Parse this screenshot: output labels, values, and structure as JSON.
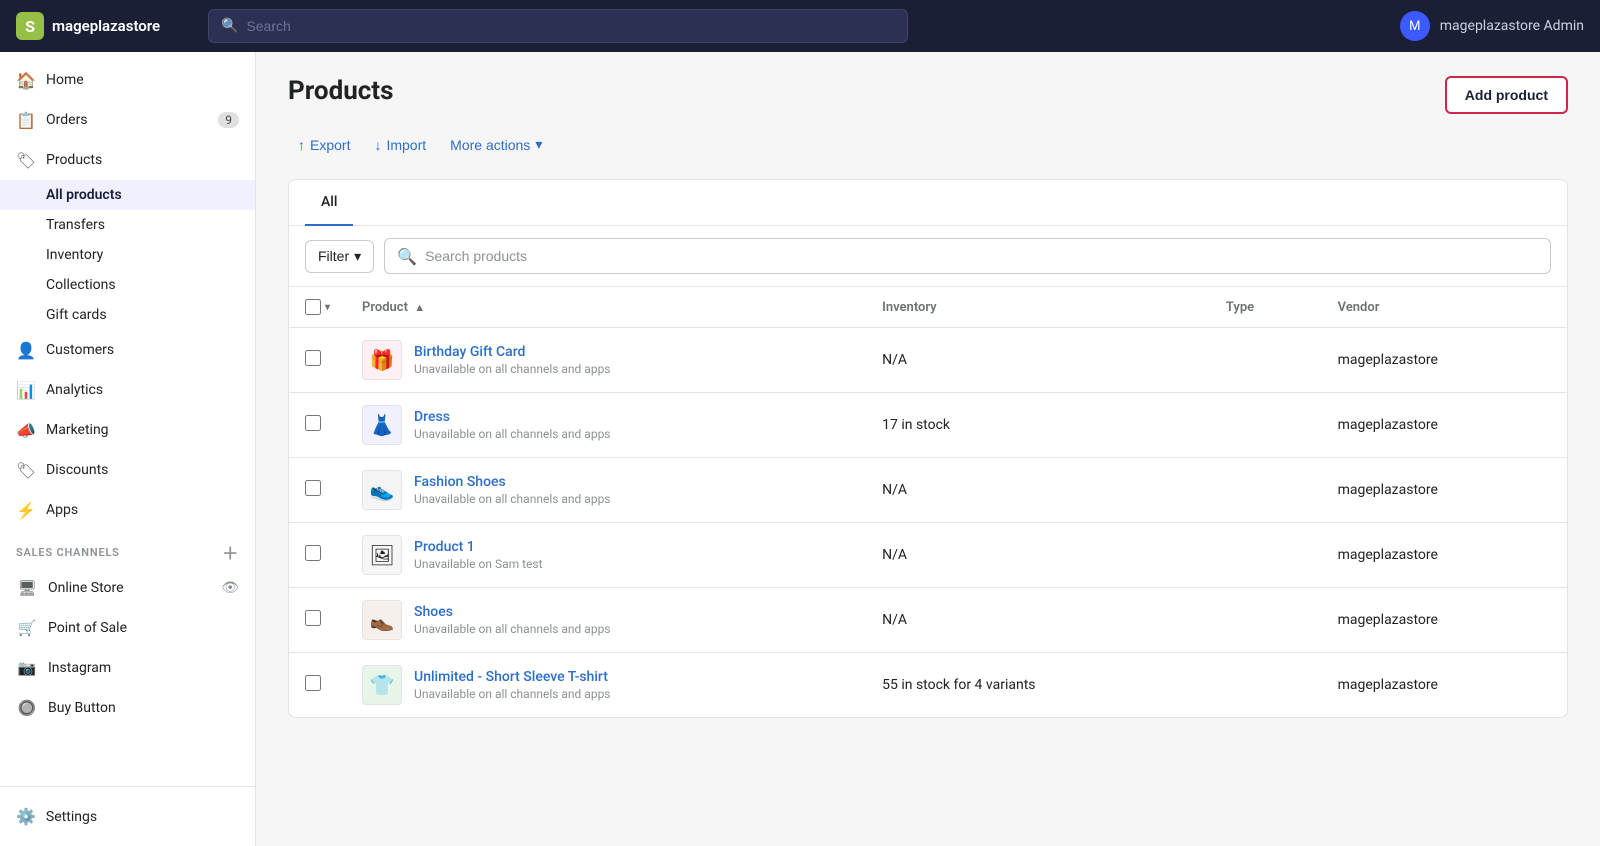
{
  "topbar": {
    "brand_name": "mageplazastore",
    "search_placeholder": "Search",
    "user_name": "mageplazastore Admin"
  },
  "sidebar": {
    "nav_items": [
      {
        "id": "home",
        "label": "Home",
        "icon": "🏠",
        "badge": null
      },
      {
        "id": "orders",
        "label": "Orders",
        "icon": "📋",
        "badge": "9"
      },
      {
        "id": "products",
        "label": "Products",
        "icon": "🏷",
        "badge": null,
        "expanded": true
      }
    ],
    "products_sub": [
      {
        "id": "all-products",
        "label": "All products",
        "active": true
      },
      {
        "id": "transfers",
        "label": "Transfers"
      },
      {
        "id": "inventory",
        "label": "Inventory"
      },
      {
        "id": "collections",
        "label": "Collections"
      },
      {
        "id": "gift-cards",
        "label": "Gift cards"
      }
    ],
    "other_nav": [
      {
        "id": "customers",
        "label": "Customers",
        "icon": "👤"
      },
      {
        "id": "analytics",
        "label": "Analytics",
        "icon": "📊"
      },
      {
        "id": "marketing",
        "label": "Marketing",
        "icon": "📣"
      },
      {
        "id": "discounts",
        "label": "Discounts",
        "icon": "🏷"
      },
      {
        "id": "apps",
        "label": "Apps",
        "icon": "⚡"
      }
    ],
    "sales_channels_label": "SALES CHANNELS",
    "sales_channels": [
      {
        "id": "online-store",
        "label": "Online Store",
        "icon": "🖥",
        "has_eye": true
      },
      {
        "id": "point-of-sale",
        "label": "Point of Sale",
        "icon": "🛒"
      },
      {
        "id": "instagram",
        "label": "Instagram",
        "icon": "📷"
      },
      {
        "id": "buy-button",
        "label": "Buy Button",
        "icon": "🔘"
      }
    ],
    "settings_label": "Settings"
  },
  "page": {
    "title": "Products",
    "add_product_label": "Add product",
    "export_label": "Export",
    "import_label": "Import",
    "more_actions_label": "More actions",
    "tabs": [
      {
        "id": "all",
        "label": "All",
        "active": true
      }
    ],
    "filter_label": "Filter",
    "search_placeholder": "Search products",
    "table": {
      "columns": [
        {
          "id": "product",
          "label": "Product",
          "sortable": true,
          "sort": "asc"
        },
        {
          "id": "inventory",
          "label": "Inventory",
          "sortable": false
        },
        {
          "id": "type",
          "label": "Type",
          "sortable": false
        },
        {
          "id": "vendor",
          "label": "Vendor",
          "sortable": false
        }
      ],
      "rows": [
        {
          "id": "1",
          "name": "Birthday Gift Card",
          "sub": "Unavailable on all channels and apps",
          "inventory": "N/A",
          "type": "",
          "vendor": "mageplazastore",
          "thumb_emoji": "🎁",
          "thumb_color": "#fff0f5"
        },
        {
          "id": "2",
          "name": "Dress",
          "sub": "Unavailable on all channels and apps",
          "inventory": "17 in stock",
          "type": "",
          "vendor": "mageplazastore",
          "thumb_emoji": "👗",
          "thumb_color": "#f0f0ff"
        },
        {
          "id": "3",
          "name": "Fashion Shoes",
          "sub": "Unavailable on all channels and apps",
          "inventory": "N/A",
          "type": "",
          "vendor": "mageplazastore",
          "thumb_emoji": "👟",
          "thumb_color": "#f5f5f5"
        },
        {
          "id": "4",
          "name": "Product 1",
          "sub": "Unavailable on Sam test",
          "inventory": "N/A",
          "type": "",
          "vendor": "mageplazastore",
          "thumb_emoji": "🖼",
          "thumb_color": "#f6f6f7"
        },
        {
          "id": "5",
          "name": "Shoes",
          "sub": "Unavailable on all channels and apps",
          "inventory": "N/A",
          "type": "",
          "vendor": "mageplazastore",
          "thumb_emoji": "👞",
          "thumb_color": "#f5f0eb"
        },
        {
          "id": "6",
          "name": "Unlimited - Short Sleeve T-shirt",
          "sub": "Unavailable on all channels and apps",
          "inventory": "55 in stock for 4 variants",
          "type": "",
          "vendor": "mageplazastore",
          "thumb_emoji": "👕",
          "thumb_color": "#e8f5e9"
        }
      ]
    }
  }
}
